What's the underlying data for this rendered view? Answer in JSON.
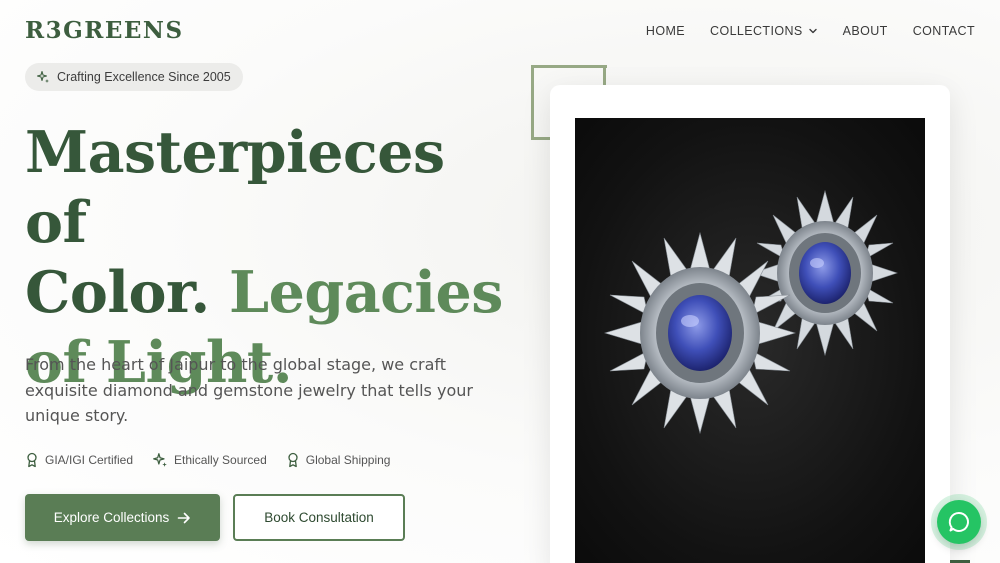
{
  "brand": {
    "logo": "R3GREENS"
  },
  "nav": {
    "items": [
      {
        "label": "HOME"
      },
      {
        "label": "COLLECTIONS"
      },
      {
        "label": "ABOUT"
      },
      {
        "label": "CONTACT"
      }
    ]
  },
  "hero": {
    "badge": "Crafting Excellence Since 2005",
    "headline_line1": "Masterpieces of",
    "headline_line2_dark": "Color. ",
    "headline_line2_accent": "Legacies",
    "headline_line3": "of Light.",
    "description": "From the heart of Jaipur to the global stage, we craft exquisite diamond and gemstone jewelry that tells your unique story.",
    "features": [
      {
        "label": "GIA/IGI Certified",
        "icon": "award-icon"
      },
      {
        "label": "Ethically Sourced",
        "icon": "sparkles-icon"
      },
      {
        "label": "Global Shipping",
        "icon": "award-icon"
      }
    ],
    "primary_button": "Explore Collections",
    "secondary_button": "Book Consultation"
  },
  "colors": {
    "brand_green": "#3d5e3f",
    "accent_green": "#5e8a5a",
    "button_green": "#5a7d55",
    "chat_green": "#25c464"
  }
}
